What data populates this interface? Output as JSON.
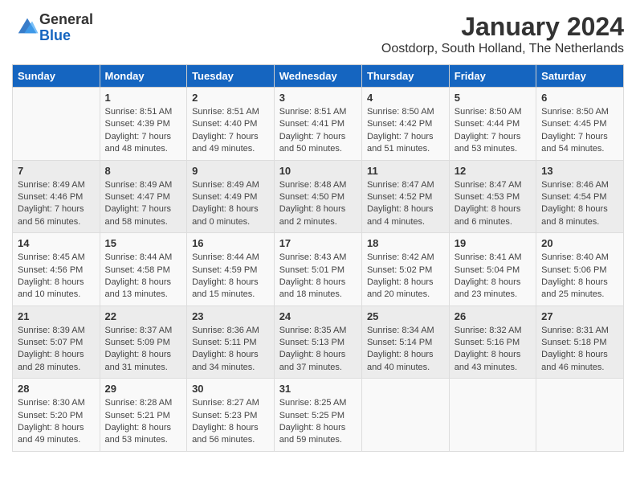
{
  "header": {
    "logo_line1": "General",
    "logo_line2": "Blue",
    "month_year": "January 2024",
    "location": "Oostdorp, South Holland, The Netherlands"
  },
  "days_of_week": [
    "Sunday",
    "Monday",
    "Tuesday",
    "Wednesday",
    "Thursday",
    "Friday",
    "Saturday"
  ],
  "weeks": [
    [
      {
        "day": "",
        "sunrise": "",
        "sunset": "",
        "daylight": ""
      },
      {
        "day": "1",
        "sunrise": "Sunrise: 8:51 AM",
        "sunset": "Sunset: 4:39 PM",
        "daylight": "Daylight: 7 hours and 48 minutes."
      },
      {
        "day": "2",
        "sunrise": "Sunrise: 8:51 AM",
        "sunset": "Sunset: 4:40 PM",
        "daylight": "Daylight: 7 hours and 49 minutes."
      },
      {
        "day": "3",
        "sunrise": "Sunrise: 8:51 AM",
        "sunset": "Sunset: 4:41 PM",
        "daylight": "Daylight: 7 hours and 50 minutes."
      },
      {
        "day": "4",
        "sunrise": "Sunrise: 8:50 AM",
        "sunset": "Sunset: 4:42 PM",
        "daylight": "Daylight: 7 hours and 51 minutes."
      },
      {
        "day": "5",
        "sunrise": "Sunrise: 8:50 AM",
        "sunset": "Sunset: 4:44 PM",
        "daylight": "Daylight: 7 hours and 53 minutes."
      },
      {
        "day": "6",
        "sunrise": "Sunrise: 8:50 AM",
        "sunset": "Sunset: 4:45 PM",
        "daylight": "Daylight: 7 hours and 54 minutes."
      }
    ],
    [
      {
        "day": "7",
        "sunrise": "Sunrise: 8:49 AM",
        "sunset": "Sunset: 4:46 PM",
        "daylight": "Daylight: 7 hours and 56 minutes."
      },
      {
        "day": "8",
        "sunrise": "Sunrise: 8:49 AM",
        "sunset": "Sunset: 4:47 PM",
        "daylight": "Daylight: 7 hours and 58 minutes."
      },
      {
        "day": "9",
        "sunrise": "Sunrise: 8:49 AM",
        "sunset": "Sunset: 4:49 PM",
        "daylight": "Daylight: 8 hours and 0 minutes."
      },
      {
        "day": "10",
        "sunrise": "Sunrise: 8:48 AM",
        "sunset": "Sunset: 4:50 PM",
        "daylight": "Daylight: 8 hours and 2 minutes."
      },
      {
        "day": "11",
        "sunrise": "Sunrise: 8:47 AM",
        "sunset": "Sunset: 4:52 PM",
        "daylight": "Daylight: 8 hours and 4 minutes."
      },
      {
        "day": "12",
        "sunrise": "Sunrise: 8:47 AM",
        "sunset": "Sunset: 4:53 PM",
        "daylight": "Daylight: 8 hours and 6 minutes."
      },
      {
        "day": "13",
        "sunrise": "Sunrise: 8:46 AM",
        "sunset": "Sunset: 4:54 PM",
        "daylight": "Daylight: 8 hours and 8 minutes."
      }
    ],
    [
      {
        "day": "14",
        "sunrise": "Sunrise: 8:45 AM",
        "sunset": "Sunset: 4:56 PM",
        "daylight": "Daylight: 8 hours and 10 minutes."
      },
      {
        "day": "15",
        "sunrise": "Sunrise: 8:44 AM",
        "sunset": "Sunset: 4:58 PM",
        "daylight": "Daylight: 8 hours and 13 minutes."
      },
      {
        "day": "16",
        "sunrise": "Sunrise: 8:44 AM",
        "sunset": "Sunset: 4:59 PM",
        "daylight": "Daylight: 8 hours and 15 minutes."
      },
      {
        "day": "17",
        "sunrise": "Sunrise: 8:43 AM",
        "sunset": "Sunset: 5:01 PM",
        "daylight": "Daylight: 8 hours and 18 minutes."
      },
      {
        "day": "18",
        "sunrise": "Sunrise: 8:42 AM",
        "sunset": "Sunset: 5:02 PM",
        "daylight": "Daylight: 8 hours and 20 minutes."
      },
      {
        "day": "19",
        "sunrise": "Sunrise: 8:41 AM",
        "sunset": "Sunset: 5:04 PM",
        "daylight": "Daylight: 8 hours and 23 minutes."
      },
      {
        "day": "20",
        "sunrise": "Sunrise: 8:40 AM",
        "sunset": "Sunset: 5:06 PM",
        "daylight": "Daylight: 8 hours and 25 minutes."
      }
    ],
    [
      {
        "day": "21",
        "sunrise": "Sunrise: 8:39 AM",
        "sunset": "Sunset: 5:07 PM",
        "daylight": "Daylight: 8 hours and 28 minutes."
      },
      {
        "day": "22",
        "sunrise": "Sunrise: 8:37 AM",
        "sunset": "Sunset: 5:09 PM",
        "daylight": "Daylight: 8 hours and 31 minutes."
      },
      {
        "day": "23",
        "sunrise": "Sunrise: 8:36 AM",
        "sunset": "Sunset: 5:11 PM",
        "daylight": "Daylight: 8 hours and 34 minutes."
      },
      {
        "day": "24",
        "sunrise": "Sunrise: 8:35 AM",
        "sunset": "Sunset: 5:13 PM",
        "daylight": "Daylight: 8 hours and 37 minutes."
      },
      {
        "day": "25",
        "sunrise": "Sunrise: 8:34 AM",
        "sunset": "Sunset: 5:14 PM",
        "daylight": "Daylight: 8 hours and 40 minutes."
      },
      {
        "day": "26",
        "sunrise": "Sunrise: 8:32 AM",
        "sunset": "Sunset: 5:16 PM",
        "daylight": "Daylight: 8 hours and 43 minutes."
      },
      {
        "day": "27",
        "sunrise": "Sunrise: 8:31 AM",
        "sunset": "Sunset: 5:18 PM",
        "daylight": "Daylight: 8 hours and 46 minutes."
      }
    ],
    [
      {
        "day": "28",
        "sunrise": "Sunrise: 8:30 AM",
        "sunset": "Sunset: 5:20 PM",
        "daylight": "Daylight: 8 hours and 49 minutes."
      },
      {
        "day": "29",
        "sunrise": "Sunrise: 8:28 AM",
        "sunset": "Sunset: 5:21 PM",
        "daylight": "Daylight: 8 hours and 53 minutes."
      },
      {
        "day": "30",
        "sunrise": "Sunrise: 8:27 AM",
        "sunset": "Sunset: 5:23 PM",
        "daylight": "Daylight: 8 hours and 56 minutes."
      },
      {
        "day": "31",
        "sunrise": "Sunrise: 8:25 AM",
        "sunset": "Sunset: 5:25 PM",
        "daylight": "Daylight: 8 hours and 59 minutes."
      },
      {
        "day": "",
        "sunrise": "",
        "sunset": "",
        "daylight": ""
      },
      {
        "day": "",
        "sunrise": "",
        "sunset": "",
        "daylight": ""
      },
      {
        "day": "",
        "sunrise": "",
        "sunset": "",
        "daylight": ""
      }
    ]
  ]
}
